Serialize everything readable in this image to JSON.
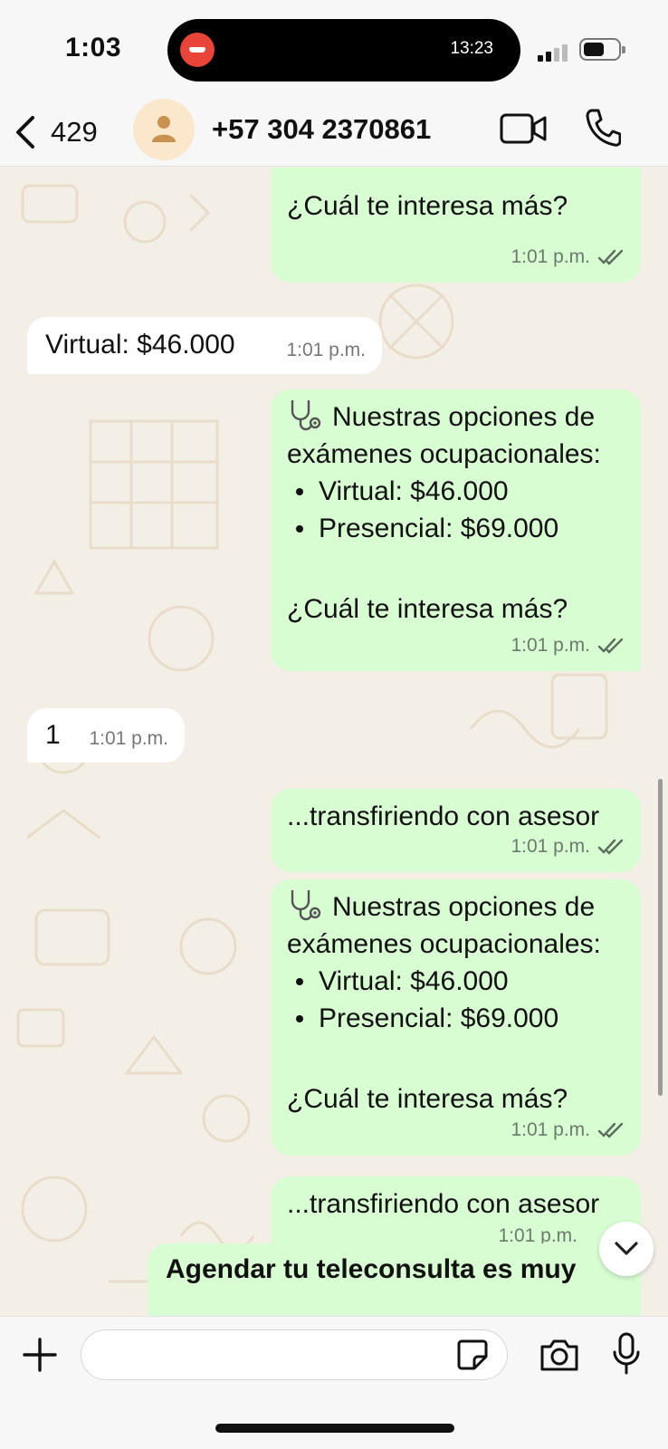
{
  "status_bar": {
    "time": "1:03",
    "island_time": "13:23"
  },
  "header": {
    "back_count": "429",
    "contact_name": "+57 304 2370861"
  },
  "messages": [
    {
      "direction": "out",
      "paragraphs": [
        "¿Cuál te interesa más?"
      ],
      "time": "1:01 p.m."
    },
    {
      "direction": "in",
      "text": "Virtual: $46.000",
      "time": "1:01 p.m."
    },
    {
      "direction": "out",
      "intro": "Nuestras opciones de exámenes ocupacionales:",
      "items": [
        "Virtual: $46.000",
        "Presencial: $69.000"
      ],
      "question": "¿Cuál te interesa más?",
      "time": "1:01 p.m."
    },
    {
      "direction": "in",
      "text": "1",
      "time": "1:01 p.m."
    },
    {
      "direction": "out",
      "text": "...transfiriendo con asesor",
      "time": "1:01 p.m."
    },
    {
      "direction": "out",
      "intro": "Nuestras opciones de exámenes ocupacionales:",
      "items": [
        "Virtual: $46.000",
        "Presencial: $69.000"
      ],
      "question": "¿Cuál te interesa más?",
      "time": "1:01 p.m."
    },
    {
      "direction": "out",
      "text": "...transfiriendo con asesor",
      "time": "1:01 p.m."
    },
    {
      "direction": "out",
      "text": "Agendar tu teleconsulta es muy"
    }
  ],
  "composer": {
    "input_value": "",
    "icons": [
      "plus-icon",
      "sticker-icon",
      "camera-icon",
      "microphone-icon"
    ]
  },
  "colors": {
    "outgoing_bubble": "#d9fdd3",
    "incoming_bubble": "#ffffff",
    "wallpaper": "#f4efe6",
    "read_ticks": "#53bdeb"
  }
}
